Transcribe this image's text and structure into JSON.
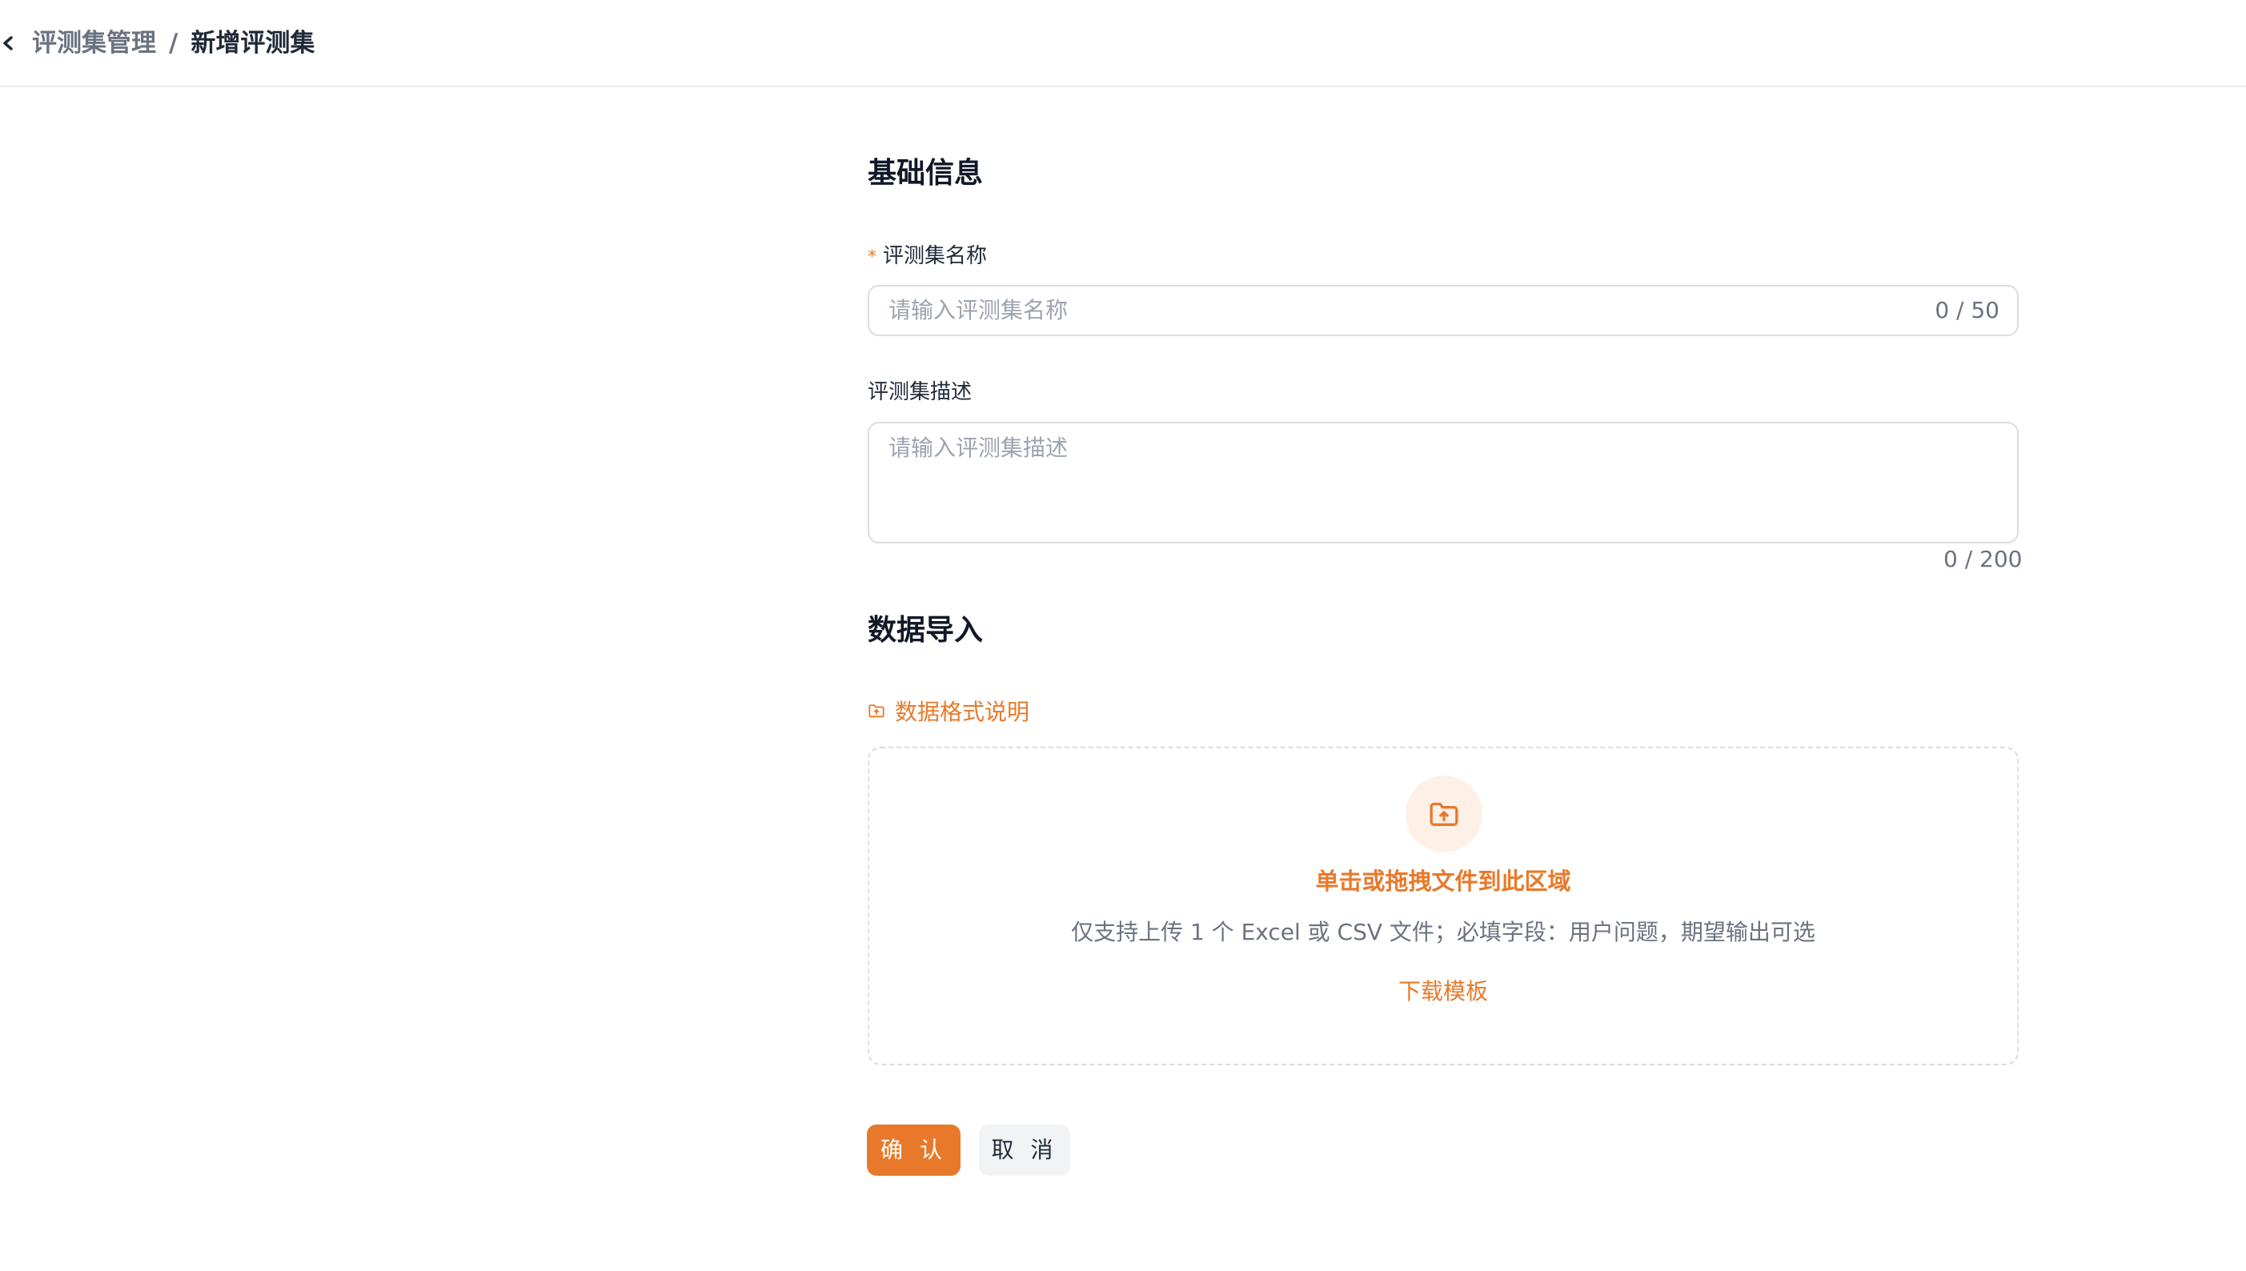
{
  "breadcrumb": {
    "parent": "评测集管理",
    "separator": "/",
    "current": "新增评测集"
  },
  "basic_info": {
    "title": "基础信息",
    "name_field": {
      "required_mark": "*",
      "label": "评测集名称",
      "placeholder": "请输入评测集名称",
      "value": "",
      "counter": "0 / 50"
    },
    "desc_field": {
      "label": "评测集描述",
      "placeholder": "请输入评测集描述",
      "value": "",
      "counter": "0 / 200"
    }
  },
  "data_import": {
    "title": "数据导入",
    "format_link": "数据格式说明",
    "dropzone": {
      "title": "单击或拖拽文件到此区域",
      "hint": "仅支持上传 1 个 Excel 或 CSV 文件；必填字段：用户问题，期望输出可选",
      "download": "下载模板"
    }
  },
  "actions": {
    "confirm": "确 认",
    "cancel": "取 消"
  },
  "colors": {
    "accent": "#e8792b",
    "accent_light": "#fdf1e7",
    "border": "#d9dde3"
  },
  "icons": {
    "back": "chevron-left-icon",
    "format": "folder-upload-icon",
    "upload": "folder-upload-icon"
  }
}
